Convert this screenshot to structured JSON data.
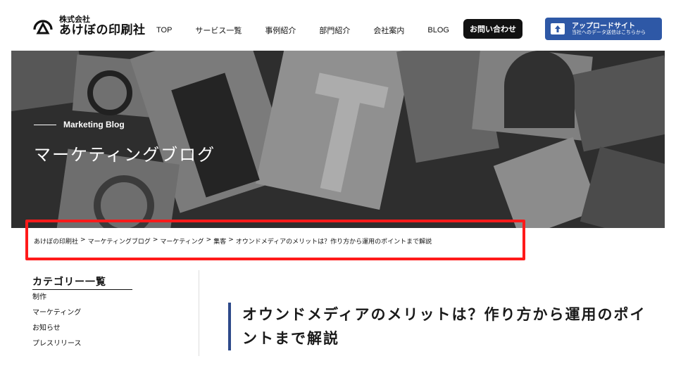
{
  "header": {
    "logo_small": "株式会社",
    "logo_big": "あけぼの印刷社",
    "nav": [
      "TOP",
      "サービス一覧",
      "事例紹介",
      "部門紹介",
      "会社案内",
      "BLOG"
    ],
    "contact_label": "お問い合わせ",
    "upload_title": "アップロードサイト",
    "upload_sub": "当社へのデータ送信はこちらから"
  },
  "hero": {
    "subtitle": "Marketing Blog",
    "title": "マーケティングブログ"
  },
  "breadcrumb": [
    "あけぼの印刷社",
    "マーケティングブログ",
    "マーケティング",
    "集客",
    "オウンドメディアのメリットは？作り方から運用のポイントまで解説"
  ],
  "breadcrumb_sep": ">",
  "sidebar": {
    "title": "カテゴリー一覧",
    "items": [
      "制作",
      "マーケティング",
      "お知らせ",
      "プレスリリース"
    ]
  },
  "article": {
    "title": "オウンドメディアのメリットは？作り方から運用のポイントまで解説"
  },
  "colors": {
    "accent_blue": "#2e58a6",
    "title_bar": "#2e4a8a",
    "highlight_red": "#ff1a1a"
  }
}
